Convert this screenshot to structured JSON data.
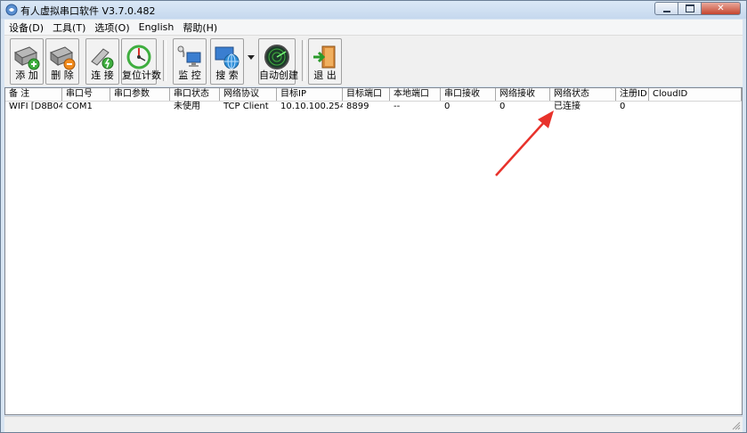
{
  "window": {
    "title": "有人虚拟串口软件 V3.7.0.482"
  },
  "menu": [
    {
      "label": "设备(D)"
    },
    {
      "label": "工具(T)"
    },
    {
      "label": "选项(O)"
    },
    {
      "label": "English"
    },
    {
      "label": "帮助(H)"
    }
  ],
  "toolbar": {
    "add": "添 加",
    "delete": "删 除",
    "connect": "连 接",
    "reset_count": "复位计数",
    "monitor": "监 控",
    "search": "搜 索",
    "auto_create": "自动创建",
    "exit": "退 出"
  },
  "table": {
    "columns": [
      "备 注",
      "串口号",
      "串口参数",
      "串口状态",
      "网络协议",
      "目标IP",
      "目标端口",
      "本地端口",
      "串口接收",
      "网络接收",
      "网络状态",
      "注册ID",
      "CloudID"
    ],
    "rows": [
      {
        "note": "WIFI [D8B04...",
        "com": "COM1",
        "params": "",
        "com_status": "未使用",
        "protocol": "TCP Client",
        "target_ip": "10.10.100.254",
        "target_port": "8899",
        "local_port": "--",
        "com_rx": "0",
        "net_rx": "0",
        "net_status": "已连接",
        "reg_id": "0",
        "cloud_id": ""
      }
    ]
  },
  "colors": {
    "annotation_arrow": "#e8322b",
    "exit_green": "#2a9a2a",
    "titlebar": "#c9dbef"
  }
}
